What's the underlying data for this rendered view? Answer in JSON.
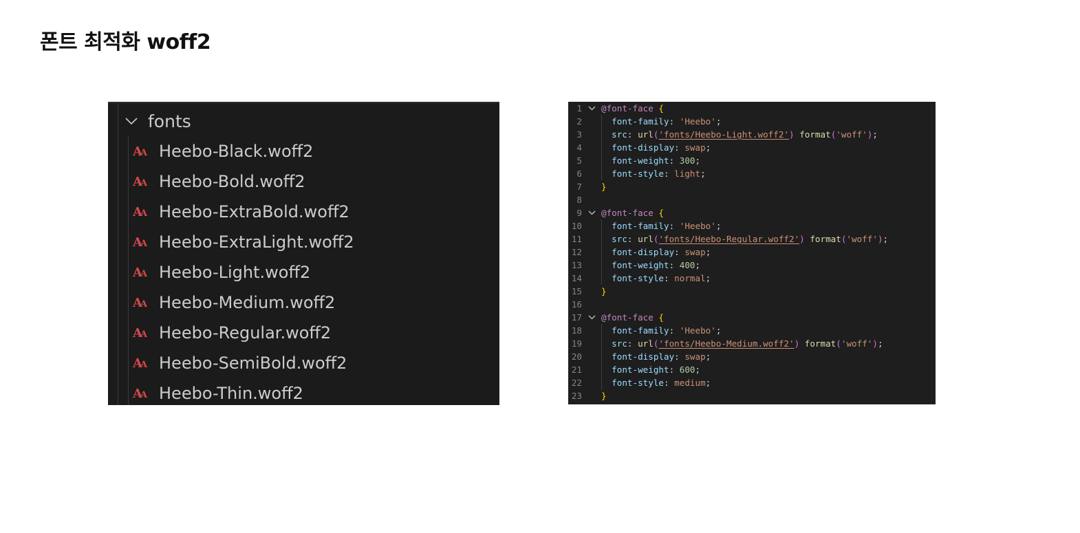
{
  "page": {
    "title": "폰트 최적화 woff2"
  },
  "explorer": {
    "folder": "fonts",
    "files": [
      "Heebo-Black.woff2",
      "Heebo-Bold.woff2",
      "Heebo-ExtraBold.woff2",
      "Heebo-ExtraLight.woff2",
      "Heebo-Light.woff2",
      "Heebo-Medium.woff2",
      "Heebo-Regular.woff2",
      "Heebo-SemiBold.woff2",
      "Heebo-Thin.woff2"
    ],
    "file_icon": "font-file-icon",
    "file_icon_color": "#d4484b"
  },
  "code": {
    "lines": [
      {
        "n": "1",
        "fold": true,
        "tokens": [
          [
            "at",
            "@font-face"
          ],
          [
            "punc",
            " "
          ],
          [
            "brace",
            "{"
          ]
        ]
      },
      {
        "n": "2",
        "tokens": [
          [
            "prop",
            "font-family"
          ],
          [
            "punc",
            ": "
          ],
          [
            "str",
            "'Heebo'"
          ],
          [
            "punc",
            ";"
          ]
        ]
      },
      {
        "n": "3",
        "tokens": [
          [
            "prop",
            "src"
          ],
          [
            "punc",
            ": "
          ],
          [
            "fn",
            "url"
          ],
          [
            "paren",
            "("
          ],
          [
            "url",
            "'fonts/Heebo-Light.woff2'"
          ],
          [
            "paren",
            ")"
          ],
          [
            "punc",
            " "
          ],
          [
            "fn",
            "format"
          ],
          [
            "paren",
            "("
          ],
          [
            "str",
            "'woff'"
          ],
          [
            "paren",
            ")"
          ],
          [
            "punc",
            ";"
          ]
        ]
      },
      {
        "n": "4",
        "tokens": [
          [
            "prop",
            "font-display"
          ],
          [
            "punc",
            ": "
          ],
          [
            "val",
            "swap"
          ],
          [
            "punc",
            ";"
          ]
        ]
      },
      {
        "n": "5",
        "tokens": [
          [
            "prop",
            "font-weight"
          ],
          [
            "punc",
            ": "
          ],
          [
            "num",
            "300"
          ],
          [
            "punc",
            ";"
          ]
        ]
      },
      {
        "n": "6",
        "tokens": [
          [
            "prop",
            "font-style"
          ],
          [
            "punc",
            ": "
          ],
          [
            "val",
            "light"
          ],
          [
            "punc",
            ";"
          ]
        ]
      },
      {
        "n": "7",
        "close": true,
        "tokens": [
          [
            "brace",
            "}"
          ]
        ]
      },
      {
        "n": "8",
        "tokens": []
      },
      {
        "n": "9",
        "fold": true,
        "tokens": [
          [
            "at",
            "@font-face"
          ],
          [
            "punc",
            " "
          ],
          [
            "brace",
            "{"
          ]
        ]
      },
      {
        "n": "10",
        "tokens": [
          [
            "prop",
            "font-family"
          ],
          [
            "punc",
            ": "
          ],
          [
            "str",
            "'Heebo'"
          ],
          [
            "punc",
            ";"
          ]
        ]
      },
      {
        "n": "11",
        "tokens": [
          [
            "prop",
            "src"
          ],
          [
            "punc",
            ": "
          ],
          [
            "fn",
            "url"
          ],
          [
            "paren",
            "("
          ],
          [
            "url",
            "'fonts/Heebo-Regular.woff2'"
          ],
          [
            "paren",
            ")"
          ],
          [
            "punc",
            " "
          ],
          [
            "fn",
            "format"
          ],
          [
            "paren",
            "("
          ],
          [
            "str",
            "'woff'"
          ],
          [
            "paren",
            ")"
          ],
          [
            "punc",
            ";"
          ]
        ]
      },
      {
        "n": "12",
        "tokens": [
          [
            "prop",
            "font-display"
          ],
          [
            "punc",
            ": "
          ],
          [
            "val",
            "swap"
          ],
          [
            "punc",
            ";"
          ]
        ]
      },
      {
        "n": "13",
        "tokens": [
          [
            "prop",
            "font-weight"
          ],
          [
            "punc",
            ": "
          ],
          [
            "num",
            "400"
          ],
          [
            "punc",
            ";"
          ]
        ]
      },
      {
        "n": "14",
        "tokens": [
          [
            "prop",
            "font-style"
          ],
          [
            "punc",
            ": "
          ],
          [
            "val",
            "normal"
          ],
          [
            "punc",
            ";"
          ]
        ]
      },
      {
        "n": "15",
        "close": true,
        "tokens": [
          [
            "brace",
            "}"
          ]
        ]
      },
      {
        "n": "16",
        "tokens": []
      },
      {
        "n": "17",
        "fold": true,
        "tokens": [
          [
            "at",
            "@font-face"
          ],
          [
            "punc",
            " "
          ],
          [
            "brace",
            "{"
          ]
        ]
      },
      {
        "n": "18",
        "tokens": [
          [
            "prop",
            "font-family"
          ],
          [
            "punc",
            ": "
          ],
          [
            "str",
            "'Heebo'"
          ],
          [
            "punc",
            ";"
          ]
        ]
      },
      {
        "n": "19",
        "tokens": [
          [
            "prop",
            "src"
          ],
          [
            "punc",
            ": "
          ],
          [
            "fn",
            "url"
          ],
          [
            "paren",
            "("
          ],
          [
            "url",
            "'fonts/Heebo-Medium.woff2'"
          ],
          [
            "paren",
            ")"
          ],
          [
            "punc",
            " "
          ],
          [
            "fn",
            "format"
          ],
          [
            "paren",
            "("
          ],
          [
            "str",
            "'woff'"
          ],
          [
            "paren",
            ")"
          ],
          [
            "punc",
            ";"
          ]
        ]
      },
      {
        "n": "20",
        "tokens": [
          [
            "prop",
            "font-display"
          ],
          [
            "punc",
            ": "
          ],
          [
            "val",
            "swap"
          ],
          [
            "punc",
            ";"
          ]
        ]
      },
      {
        "n": "21",
        "tokens": [
          [
            "prop",
            "font-weight"
          ],
          [
            "punc",
            ": "
          ],
          [
            "num",
            "600"
          ],
          [
            "punc",
            ";"
          ]
        ]
      },
      {
        "n": "22",
        "tokens": [
          [
            "prop",
            "font-style"
          ],
          [
            "punc",
            ": "
          ],
          [
            "val",
            "medium"
          ],
          [
            "punc",
            ";"
          ]
        ]
      },
      {
        "n": "23",
        "close": true,
        "tokens": [
          [
            "brace",
            "}"
          ]
        ]
      }
    ]
  }
}
